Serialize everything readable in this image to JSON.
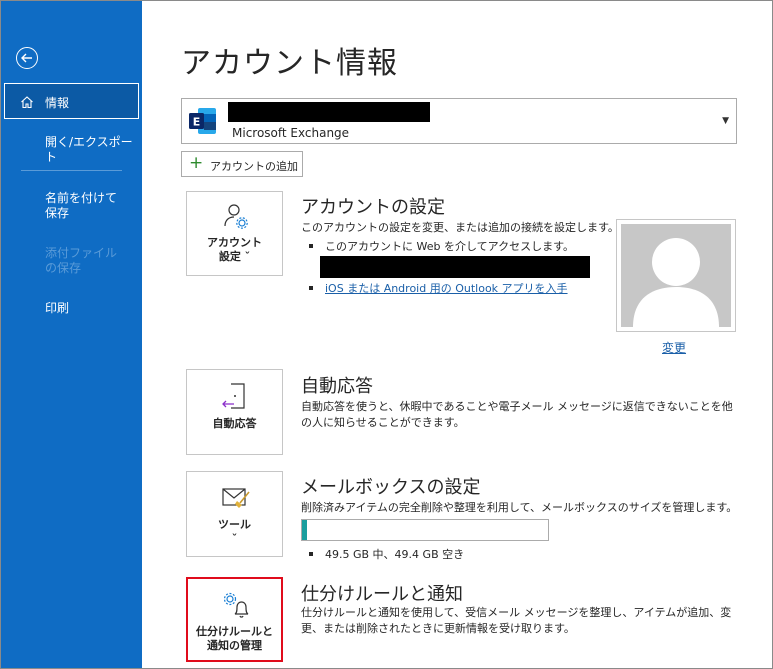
{
  "sidebar": {
    "items": [
      {
        "label": "情報",
        "active": true
      },
      {
        "label": "開く/エクスポート"
      },
      {
        "label": "名前を付けて保存"
      },
      {
        "label": "添付ファイルの保存",
        "disabled": true
      },
      {
        "label": "印刷"
      }
    ]
  },
  "page": {
    "title": "アカウント情報"
  },
  "account": {
    "type": "Microsoft Exchange",
    "add_label": "アカウントの追加"
  },
  "settings": {
    "tile_label_1": "アカウント",
    "tile_label_2": "設定 ˇ",
    "title": "アカウントの設定",
    "desc": "このアカウントの設定を変更、または追加の接続を設定します。",
    "bullet1": "このアカウントに Web を介してアクセスします。",
    "link": "iOS または Android 用の Outlook アプリを入手",
    "change_photo": "変更"
  },
  "auto_reply": {
    "tile_label": "自動応答",
    "title": "自動応答",
    "desc": "自動応答を使うと、休暇中であることや電子メール メッセージに返信できないことを他の人に知らせることができます。"
  },
  "mailbox": {
    "tile_label": "ツール",
    "tile_caret": "ˇ",
    "title": "メールボックスの設定",
    "desc": "削除済みアイテムの完全削除や整理を利用して、メールボックスのサイズを管理します。",
    "storage_text": "49.5 GB 中、49.4 GB 空き",
    "used_fraction": 0.02
  },
  "rules": {
    "tile_label_1": "仕分けルールと",
    "tile_label_2": "通知の管理",
    "title": "仕分けルールと通知",
    "desc": "仕分けルールと通知を使用して、受信メール メッセージを整理し、アイテムが追加、変更、または削除されたときに更新情報を受け取ります。"
  },
  "colors": {
    "sidebar": "#0f6cc4",
    "accent": "#1a9e9e",
    "highlight": "#e00c1c"
  }
}
